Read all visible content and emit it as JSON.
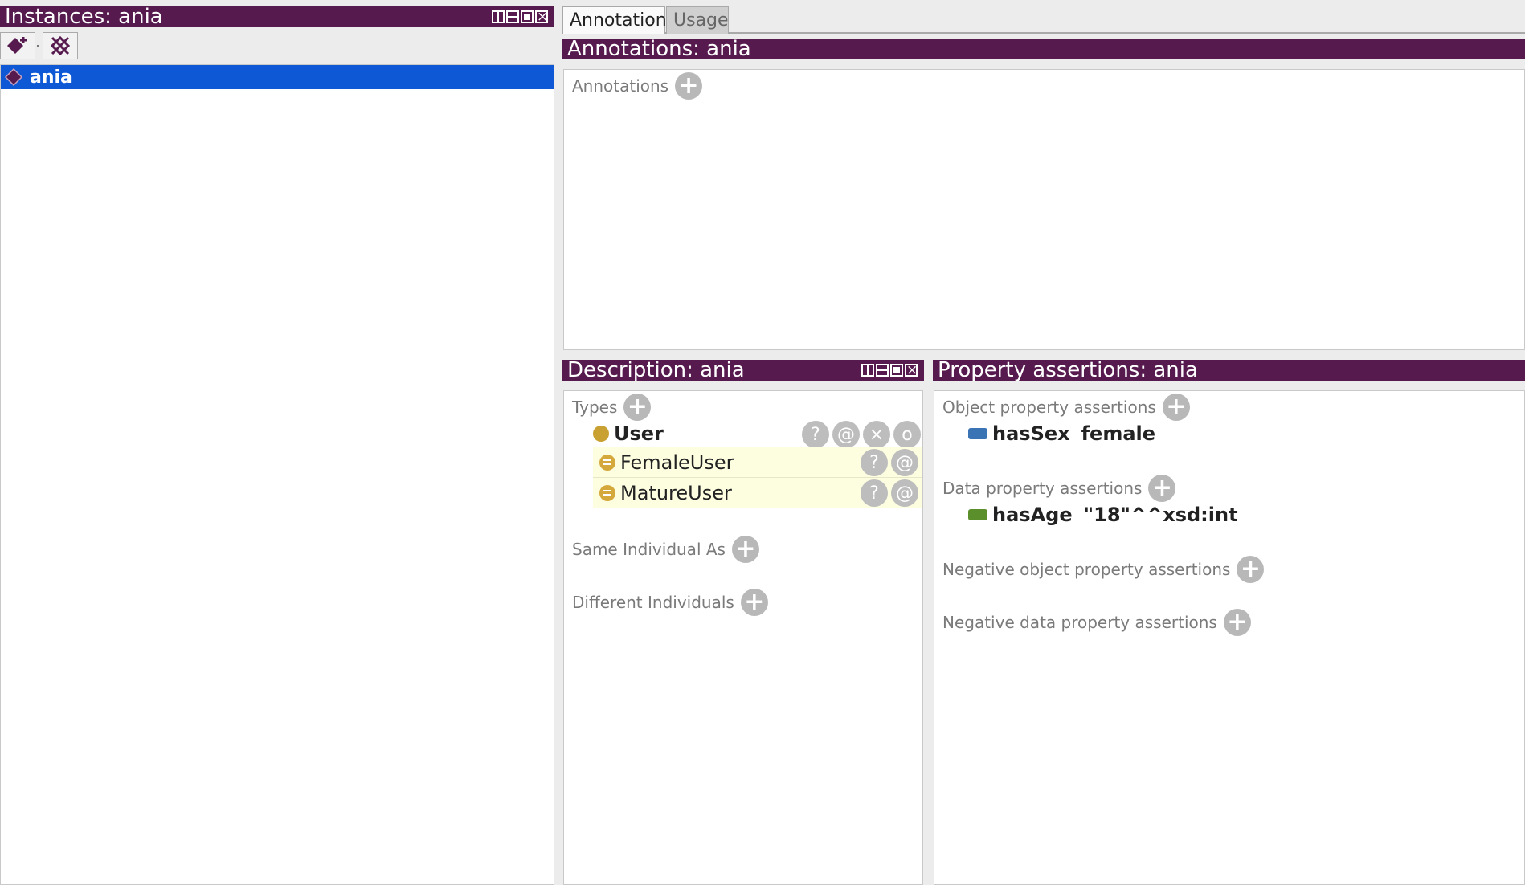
{
  "instances_panel": {
    "title": "Instances: ania",
    "selected_individual": "ania"
  },
  "tabs": [
    {
      "label": "Annotations",
      "active": true
    },
    {
      "label": "Usage",
      "active": false
    }
  ],
  "annotations_panel": {
    "title": "Annotations: ania",
    "section_label": "Annotations"
  },
  "description_panel": {
    "title": "Description: ania",
    "types_label": "Types",
    "types": [
      {
        "label": "User",
        "kind": "asserted"
      },
      {
        "label": "FemaleUser",
        "kind": "inferred"
      },
      {
        "label": "MatureUser",
        "kind": "inferred"
      }
    ],
    "type_button_glyphs": {
      "explain": "?",
      "annotate": "@",
      "delete": "×",
      "edit": "o"
    },
    "same_individual_label": "Same Individual As",
    "different_individuals_label": "Different Individuals"
  },
  "property_panel": {
    "title": "Property assertions: ania",
    "object_label": "Object property assertions",
    "object_assertions": [
      {
        "property": "hasSex",
        "value": "female"
      }
    ],
    "data_label": "Data property assertions",
    "data_assertions": [
      {
        "property": "hasAge",
        "value": "\"18\"^^xsd:int"
      }
    ],
    "neg_object_label": "Negative object property assertions",
    "neg_data_label": "Negative data property assertions"
  },
  "colors": {
    "title_bar": "#561a4f",
    "selection": "#0e58d6",
    "inferred_row": "#fdfde0",
    "class_icon": "#c9a132",
    "object_property_icon": "#3a74b4",
    "data_property_icon": "#5b8f2b"
  }
}
